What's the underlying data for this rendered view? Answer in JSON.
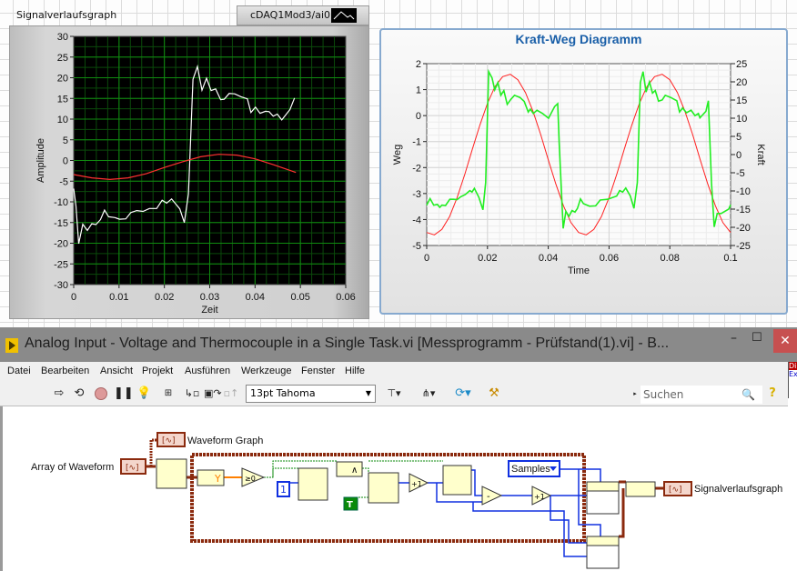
{
  "front_panel": {
    "waveform_graph": {
      "label": "Signalverlaufsgraph",
      "legend_plot_name": "cDAQ1Mod3/ai0",
      "colors": {
        "plot_bg": "#000000",
        "grid": "#0f7a0f",
        "signal": "#ffffff",
        "second": "#ff3030"
      }
    },
    "xy_graph": {
      "title": "Kraft-Weg Diagramm",
      "colors": {
        "title": "#1a5fa8",
        "weg": "#ff2020",
        "kraft": "#22ee22",
        "border": "#86a9cf"
      }
    }
  },
  "chart_data": [
    {
      "type": "line",
      "title": "",
      "xlabel": "Zeit",
      "ylabel": "Amplitude",
      "xlim": [
        0,
        0.06
      ],
      "ylim": [
        -30,
        30
      ],
      "xticks": [
        "0",
        "0.01",
        "0.02",
        "0.03",
        "0.04",
        "0.05",
        "0.06"
      ],
      "yticks": [
        "30",
        "25",
        "20",
        "15",
        "10",
        "5",
        "0",
        "-5",
        "-10",
        "-15",
        "-20",
        "-25",
        "-30"
      ],
      "grid": true,
      "series": [
        {
          "name": "cDAQ1Mod3/ai0",
          "color": "#ffffff",
          "x": [
            0,
            0.0005,
            0.0011,
            0.002,
            0.003,
            0.004,
            0.0049,
            0.0059,
            0.0068,
            0.0077,
            0.0091,
            0.0101,
            0.0115,
            0.0126,
            0.0139,
            0.0153,
            0.0167,
            0.0183,
            0.0195,
            0.0205,
            0.0216,
            0.0234,
            0.0244,
            0.0253,
            0.0257,
            0.0263,
            0.0273,
            0.0283,
            0.0293,
            0.0303,
            0.0313,
            0.0324,
            0.0332,
            0.0343,
            0.0355,
            0.0369,
            0.0383,
            0.0391,
            0.0401,
            0.0411,
            0.0423,
            0.0431,
            0.044,
            0.0449,
            0.0459,
            0.0477,
            0.0487
          ],
          "y": [
            -6.8,
            -11,
            -20.1,
            -15.4,
            -16.9,
            -15.3,
            -15.5,
            -14.3,
            -12,
            -13.6,
            -13.8,
            -14.2,
            -14.1,
            -12.6,
            -12.1,
            -12.3,
            -11.6,
            -11.6,
            -9.6,
            -10.3,
            -9.3,
            -11.7,
            -15,
            -8.1,
            2.8,
            19.6,
            22.7,
            17,
            19.9,
            16.9,
            17.3,
            14.7,
            14.8,
            16.2,
            16.1,
            15.4,
            14.9,
            11.6,
            12.9,
            11.4,
            11.9,
            11.8,
            10.7,
            11.2,
            9.8,
            12.3,
            15.1
          ]
        },
        {
          "color": "#ff3030",
          "x": [
            0,
            0.004,
            0.008,
            0.012,
            0.016,
            0.02,
            0.024,
            0.028,
            0.032,
            0.036,
            0.04,
            0.044,
            0.048,
            0.049
          ],
          "y": [
            -3.4,
            -4.2,
            -4.6,
            -4.2,
            -3.2,
            -1.7,
            -0.3,
            0.9,
            1.5,
            1.3,
            0.4,
            -1.0,
            -2.5,
            -2.9
          ]
        }
      ]
    },
    {
      "type": "line",
      "title": "Kraft-Weg Diagramm",
      "xlabel": "Time",
      "ylabel": "Weg",
      "y2label": "Kraft",
      "xlim": [
        0,
        0.1
      ],
      "ylim": [
        -5,
        2
      ],
      "y2lim": [
        -25,
        25
      ],
      "xticks": [
        "0",
        "0.02",
        "0.04",
        "0.06",
        "0.08",
        "0.1"
      ],
      "yticks": [
        "2",
        "1",
        "0",
        "-1",
        "-2",
        "-3",
        "-4",
        "-5"
      ],
      "y2ticks": [
        "25",
        "20",
        "15",
        "10",
        "5",
        "0",
        "-5",
        "-10",
        "-15",
        "-20",
        "-25"
      ],
      "grid": true,
      "series": [
        {
          "name": "Weg",
          "axis": "left",
          "color": "#ff2020",
          "x": [
            0,
            0.0025,
            0.005,
            0.0075,
            0.01,
            0.0125,
            0.015,
            0.0175,
            0.02,
            0.0225,
            0.025,
            0.0275,
            0.03,
            0.0325,
            0.035,
            0.0375,
            0.04,
            0.0425,
            0.045,
            0.0475,
            0.05,
            0.0525,
            0.055,
            0.0575,
            0.06,
            0.0625,
            0.065,
            0.0675,
            0.07,
            0.0725,
            0.075,
            0.0775,
            0.08,
            0.0825,
            0.085,
            0.0875,
            0.09,
            0.0925,
            0.095,
            0.0975,
            0.1
          ],
          "y": [
            -4.5,
            -4.59,
            -4.38,
            -3.89,
            -3.16,
            -2.27,
            -1.3,
            -0.36,
            0.47,
            1.12,
            1.5,
            1.59,
            1.38,
            0.89,
            0.16,
            -0.73,
            -1.7,
            -2.64,
            -3.47,
            -4.12,
            -4.5,
            -4.59,
            -4.38,
            -3.89,
            -3.16,
            -2.27,
            -1.3,
            -0.36,
            0.47,
            1.12,
            1.5,
            1.59,
            1.38,
            0.89,
            0.16,
            -0.73,
            -1.7,
            -2.64,
            -3.47,
            -4.12,
            -4.5
          ]
        },
        {
          "name": "Kraft",
          "axis": "right",
          "color": "#22ee22",
          "x": [
            0,
            0.0011,
            0.0023,
            0.0035,
            0.0043,
            0.005,
            0.0062,
            0.0076,
            0.0088,
            0.01,
            0.0112,
            0.0127,
            0.0142,
            0.0149,
            0.0157,
            0.0172,
            0.0185,
            0.0194,
            0.0204,
            0.0215,
            0.0224,
            0.0234,
            0.0244,
            0.0254,
            0.0265,
            0.0277,
            0.0289,
            0.0307,
            0.0321,
            0.0334,
            0.0341,
            0.0351,
            0.0363,
            0.0381,
            0.0401,
            0.0421,
            0.0431,
            0.0436,
            0.0449,
            0.0458,
            0.0468,
            0.0478,
            0.0488,
            0.0496,
            0.0506,
            0.0516,
            0.0536,
            0.0556,
            0.0571,
            0.0595,
            0.0625,
            0.0635,
            0.0645,
            0.0655,
            0.067,
            0.0682,
            0.0693,
            0.0703,
            0.0712,
            0.0722,
            0.0733,
            0.0743,
            0.0752,
            0.0763,
            0.0775,
            0.0785,
            0.0803,
            0.0823,
            0.0832,
            0.0842,
            0.0855,
            0.087,
            0.0883,
            0.0894,
            0.0899,
            0.0919,
            0.0927,
            0.0937,
            0.0946,
            0.0956,
            0.0969,
            0.0994,
            0.1
          ],
          "y": [
            -13.9,
            -12.1,
            -13.9,
            -13.7,
            -14.5,
            -13.9,
            -14,
            -12.3,
            -12.3,
            -12.4,
            -11.6,
            -11,
            -9.9,
            -10.3,
            -9.3,
            -11.8,
            -15.2,
            -7.7,
            22.8,
            21.1,
            17.8,
            19.8,
            16.3,
            17.6,
            13.8,
            15.2,
            16.3,
            15.7,
            14.6,
            11.7,
            12.5,
            11.3,
            12.2,
            11.3,
            10,
            13.2,
            14,
            3.2,
            -20.3,
            -15.6,
            -17,
            -15.4,
            -15.8,
            -14.8,
            -12.2,
            -13.5,
            -14.2,
            -14.1,
            -12.5,
            -12.3,
            -11.4,
            -9.9,
            -10.3,
            -9.2,
            -11.4,
            -14.8,
            -7.7,
            19.8,
            22.8,
            17.2,
            20,
            16.9,
            17.6,
            14.7,
            15,
            16.3,
            15.7,
            14.8,
            11.7,
            12.8,
            11.5,
            12.2,
            10.7,
            11.3,
            10.1,
            11.9,
            14.8,
            -7.7,
            -19.9,
            -16.2,
            -16.2,
            -15,
            -13.8
          ]
        }
      ]
    }
  ],
  "window": {
    "title": "Analog Input - Voltage and Thermocouple in a Single Task.vi [Messprogramm - Prüfstand(1).vi] - B...",
    "minimize": "–",
    "maximize": "☐",
    "close": "✕"
  },
  "menu": [
    "Datei",
    "Bearbeiten",
    "Ansicht",
    "Projekt",
    "Ausführen",
    "Werkzeuge",
    "Fenster",
    "Hilfe"
  ],
  "toolbar": {
    "font": "13pt Tahoma",
    "search_placeholder": "Suchen",
    "help": "?",
    "icons": [
      "run-arrow-icon",
      "run-continuously-icon",
      "abort-icon",
      "pause-icon",
      "highlight-execution-icon",
      "retain-wire-values-icon",
      "step-into-icon",
      "step-over-icon",
      "step-out-icon",
      "align-icon",
      "distribute-icon",
      "reorder-icon",
      "cleanup-diagram-icon",
      "search-icon",
      "help-icon"
    ]
  },
  "side_window": {
    "line1": "Di",
    "line2": "Ex"
  },
  "block_diagram": {
    "array_of_waveform": "Array of Waveform",
    "waveform_graph": "Waveform Graph",
    "signalverlaufsgraph": "Signalverlaufsgraph",
    "samples": "Samples",
    "const_one": "1",
    "const_true": "T",
    "get_y": "Y",
    "ge_zero": "≥0",
    "increment": "+1",
    "subtract": "-",
    "and": "∧",
    "colors": {
      "waveform_wire": "#8b2a0e",
      "numeric_wire": "#1030e0",
      "boolean_wire": "#0a8a0a",
      "orange_wire": "#ff8000",
      "node_fill": "#ffffcc"
    }
  }
}
